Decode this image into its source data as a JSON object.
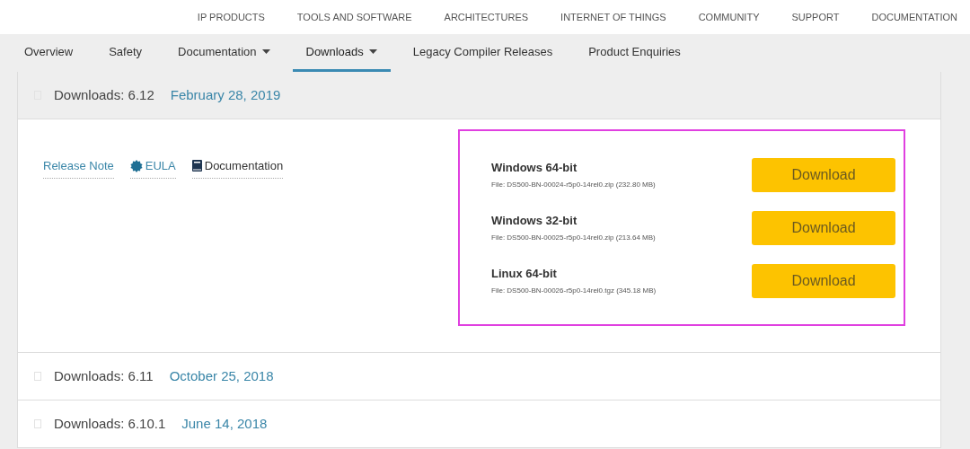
{
  "top_nav": [
    "IP PRODUCTS",
    "TOOLS AND SOFTWARE",
    "ARCHITECTURES",
    "INTERNET OF THINGS",
    "COMMUNITY",
    "SUPPORT",
    "DOCUMENTATION"
  ],
  "tabs": [
    {
      "label": "Overview",
      "selected": false,
      "dropdown": false
    },
    {
      "label": "Safety",
      "selected": false,
      "dropdown": false
    },
    {
      "label": "Documentation",
      "selected": false,
      "dropdown": true
    },
    {
      "label": "Downloads",
      "selected": true,
      "dropdown": true
    },
    {
      "label": "Legacy Compiler Releases",
      "selected": false,
      "dropdown": false
    },
    {
      "label": "Product Enquiries",
      "selected": false,
      "dropdown": false
    }
  ],
  "releases": [
    {
      "title": "Downloads: 6.12",
      "date": "February 28, 2019",
      "expanded": true,
      "links": [
        {
          "kind": "plain",
          "label": "Release Note"
        },
        {
          "kind": "badge",
          "label": "EULA"
        },
        {
          "kind": "book",
          "label": "Documentation"
        }
      ],
      "downloads": [
        {
          "name": "Windows 64-bit",
          "file": "File: DS500-BN-00024-r5p0-14rel0.zip (232.80 MB)",
          "button": "Download"
        },
        {
          "name": "Windows 32-bit",
          "file": "File: DS500-BN-00025-r5p0-14rel0.zip (213.64 MB)",
          "button": "Download"
        },
        {
          "name": "Linux 64-bit",
          "file": "File: DS500-BN-00026-r5p0-14rel0.tgz (345.18 MB)",
          "button": "Download"
        }
      ]
    },
    {
      "title": "Downloads: 6.11",
      "date": "October 25, 2018",
      "expanded": false
    },
    {
      "title": "Downloads: 6.10.1",
      "date": "June 14, 2018",
      "expanded": false
    }
  ]
}
